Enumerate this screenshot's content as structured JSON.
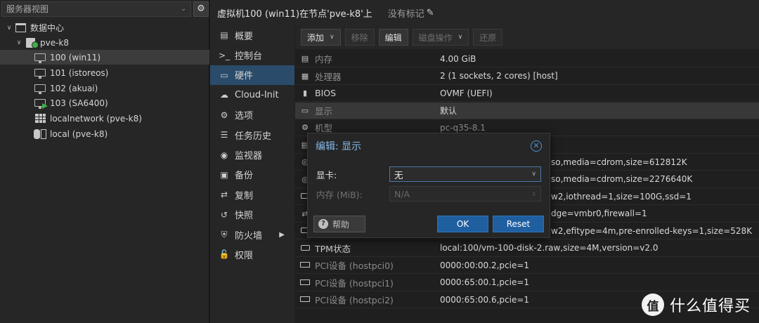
{
  "tree": {
    "view_label": "服务器视图",
    "nodes": [
      {
        "label": "数据中心",
        "icon": "datacenter-icon"
      },
      {
        "label": "pve-k8",
        "icon": "node-icon"
      },
      {
        "label": "100 (win11)",
        "icon": "vm-icon"
      },
      {
        "label": "101 (istoreos)",
        "icon": "vm-icon"
      },
      {
        "label": "102 (akuai)",
        "icon": "vm-icon"
      },
      {
        "label": "103 (SA6400)",
        "icon": "vm-running-icon"
      },
      {
        "label": "localnetwork (pve-k8)",
        "icon": "network-icon"
      },
      {
        "label": "local (pve-k8)",
        "icon": "storage-icon"
      }
    ]
  },
  "header": {
    "title": "虚拟机100 (win11)在节点'pve-k8'上",
    "tags": "没有标记"
  },
  "menu": {
    "items": [
      {
        "label": "概要",
        "icon": "book-icon"
      },
      {
        "label": "控制台",
        "icon": "terminal-icon"
      },
      {
        "label": "硬件",
        "icon": "monitor-icon"
      },
      {
        "label": "Cloud-Init",
        "icon": "cloud-icon"
      },
      {
        "label": "选项",
        "icon": "gear-icon"
      },
      {
        "label": "任务历史",
        "icon": "list-icon"
      },
      {
        "label": "监视器",
        "icon": "eye-icon"
      },
      {
        "label": "备份",
        "icon": "floppy-icon"
      },
      {
        "label": "复制",
        "icon": "retweet-icon"
      },
      {
        "label": "快照",
        "icon": "history-icon"
      },
      {
        "label": "防火墙",
        "icon": "shield-icon"
      },
      {
        "label": "权限",
        "icon": "unlock-icon"
      }
    ]
  },
  "toolbar": {
    "add": "添加",
    "remove": "移除",
    "edit": "编辑",
    "disk_action": "磁盘操作",
    "revert": "还原"
  },
  "hardware": {
    "rows": [
      {
        "name": "内存",
        "value": "4.00 GiB",
        "icon": "memory-icon"
      },
      {
        "name": "处理器",
        "value": "2 (1 sockets, 2 cores) [host]",
        "icon": "cpu-icon"
      },
      {
        "name": "BIOS",
        "value": "OVMF (UEFI)",
        "icon": "bios-icon"
      },
      {
        "name": "显示",
        "value": "默认",
        "icon": "display-icon"
      },
      {
        "name": "机型",
        "value": "pc-q35-8.1",
        "icon": "cogs-icon"
      },
      {
        "name": "",
        "value": "",
        "icon": "database-icon"
      },
      {
        "name": "",
        "value": "so,media=cdrom,size=612812K",
        "icon": "cdrom-icon"
      },
      {
        "name": "",
        "value": "so,media=cdrom,size=2276640K",
        "icon": "cdrom-icon"
      },
      {
        "name": "",
        "value": "w2,iothread=1,size=100G,ssd=1",
        "icon": "hdd-icon"
      },
      {
        "name": "",
        "value": "dge=vmbr0,firewall=1",
        "icon": "network-icon"
      },
      {
        "name": "",
        "value": "w2,efitype=4m,pre-enrolled-keys=1,size=528K",
        "icon": "hdd-icon"
      },
      {
        "name": "TPM状态",
        "value": "local:100/vm-100-disk-2.raw,size=4M,version=v2.0",
        "icon": "hdd-icon"
      },
      {
        "name": "PCI设备 (hostpci0)",
        "value": "0000:00:00.2,pcie=1",
        "icon": "pci-icon"
      },
      {
        "name": "PCI设备 (hostpci1)",
        "value": "0000:65:00.1,pcie=1",
        "icon": "pci-icon"
      },
      {
        "name": "PCI设备 (hostpci2)",
        "value": "0000:65:00.6,pcie=1",
        "icon": "pci-icon"
      }
    ]
  },
  "dialog": {
    "title": "编辑: 显示",
    "graphic_label": "显卡:",
    "graphic_value": "无",
    "memory_label": "内存 (MiB):",
    "memory_placeholder": "N/A",
    "help": "帮助",
    "ok": "OK",
    "reset": "Reset"
  },
  "watermark": {
    "logo": "值",
    "text": "什么值得买"
  }
}
